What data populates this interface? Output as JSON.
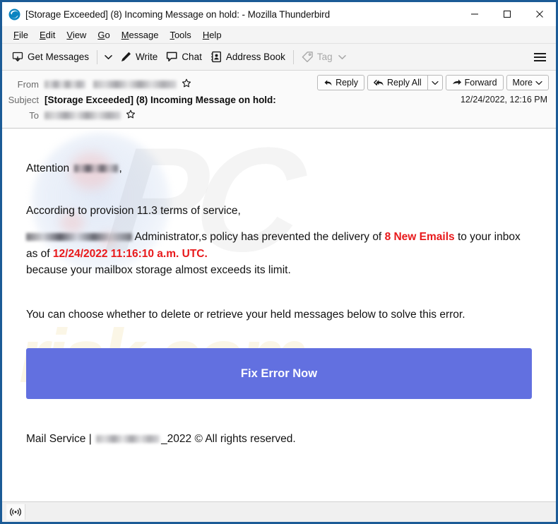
{
  "window": {
    "title": "[Storage Exceeded] (8) Incoming Message on hold: - Mozilla Thunderbird",
    "app_icon": "thunderbird-icon",
    "controls": {
      "minimize": "minimize-icon",
      "maximize": "maximize-icon",
      "close": "close-icon"
    },
    "frame_color": "#1b5b96"
  },
  "menubar": {
    "items": [
      {
        "label": "File",
        "accel": "F"
      },
      {
        "label": "Edit",
        "accel": "E"
      },
      {
        "label": "View",
        "accel": "V"
      },
      {
        "label": "Go",
        "accel": "G"
      },
      {
        "label": "Message",
        "accel": "M"
      },
      {
        "label": "Tools",
        "accel": "T"
      },
      {
        "label": "Help",
        "accel": "H"
      }
    ]
  },
  "toolbar": {
    "get_messages": "Get Messages",
    "write": "Write",
    "chat": "Chat",
    "address_book": "Address Book",
    "tag": "Tag",
    "tag_disabled": true,
    "app_menu": "hamburger-icon"
  },
  "message_header": {
    "from_label": "From",
    "from_value_redacted": true,
    "subject_label": "Subject",
    "subject_value": "[Storage Exceeded] (8) Incoming Message on hold:",
    "to_label": "To",
    "to_value_redacted": true,
    "date": "12/24/2022, 12:16 PM",
    "actions": {
      "reply": "Reply",
      "reply_all": "Reply All",
      "forward": "Forward",
      "more": "More"
    }
  },
  "email_body": {
    "greeting_prefix": "Attention",
    "greeting_suffix": ",",
    "provision_line": "According to provision 11.3 terms of service,",
    "main_part1": "Administrator,s policy has prevented the delivery of",
    "new_emails_count": "8 New Emails",
    "main_part2": "to your inbox as of",
    "held_datetime": "12/24/2022 11:16:10 a.m. UTC.",
    "main_part3": "because your mailbox storage almost exceeds its limit.",
    "choose_line": "You can choose whether to delete or retrieve your held messages below to solve this error.",
    "cta_button": "Fix Error Now",
    "footer_prefix": "Mail Service |",
    "footer_suffix": "_2022 © All rights reserved.",
    "accent_red": "#e8191b",
    "cta_color": "#6270e0",
    "watermark_pc": "PC",
    "watermark_risk": "risk.com"
  },
  "statusbar": {
    "icon": "rss-broadcast-icon"
  }
}
